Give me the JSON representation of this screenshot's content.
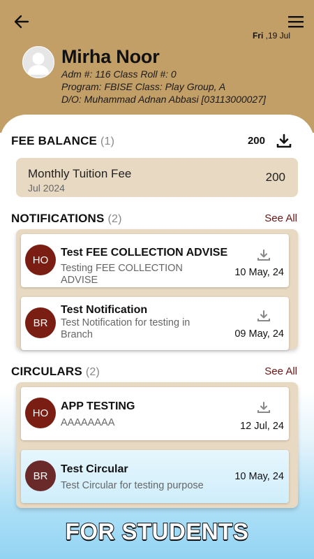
{
  "header": {
    "date_day": "Fri",
    "date_rest": " ,19 Jul",
    "student_name": "Mirha Noor",
    "adm_line": "Adm #: 116 Class Roll #: 0",
    "program_line": "Program: FBISE Class: Play Group, A",
    "parent_line": "D/O: Muhammad Adnan Abbasi [03113000027]",
    "brand_color": "#c39f68"
  },
  "fee": {
    "title": "FEE BALANCE",
    "count": "(1)",
    "total": "200",
    "items": [
      {
        "name": "Monthly Tuition Fee",
        "month": "Jul 2024",
        "amount": "200"
      }
    ]
  },
  "notifications": {
    "title": "NOTIFICATIONS",
    "count": "(2)",
    "see_all": "See All",
    "items": [
      {
        "initials": "HO",
        "title": "Test FEE COLLECTION ADVISE",
        "desc": "Testing FEE COLLECTION ADVISE",
        "date": "10 May, 24",
        "icon": "download-icon"
      },
      {
        "initials": "BR",
        "title": "Test Notification",
        "desc": "Test Notification for testing in Branch",
        "date": "09 May, 24",
        "icon": "download-icon"
      }
    ]
  },
  "circulars": {
    "title": "CIRCULARS",
    "count": "(2)",
    "see_all": "See All",
    "items": [
      {
        "initials": "HO",
        "title": "APP TESTING",
        "desc": "AAAAAAAA",
        "date": "12 Jul, 24",
        "icon": "download-icon"
      },
      {
        "initials": "BR",
        "title": "Test Circular",
        "desc": "Test Circular for testing purpose",
        "date": "10 May, 24"
      }
    ]
  },
  "banner": "FOR STUDENTS",
  "colors": {
    "accent": "#6b1414",
    "avatar_bg": "#7a1d12",
    "card_bg": "#e8d9c2"
  }
}
